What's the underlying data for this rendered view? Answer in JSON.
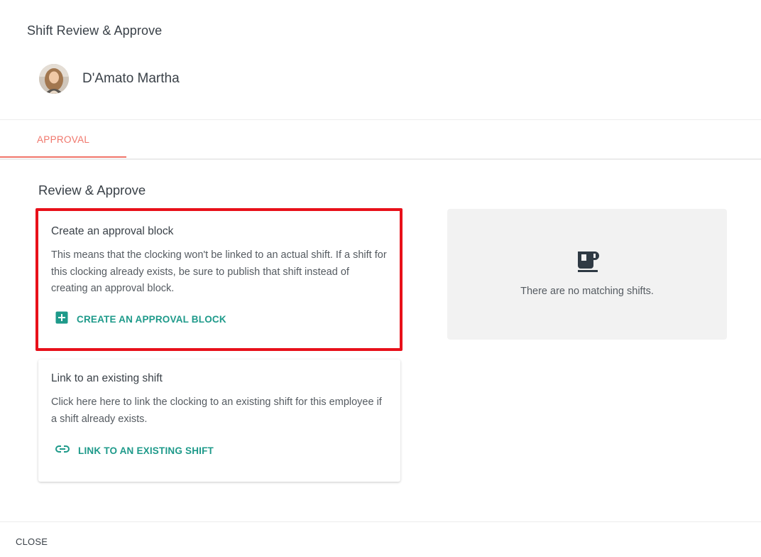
{
  "dialog": {
    "title": "Shift Review & Approve"
  },
  "employee": {
    "name": "D'Amato Martha"
  },
  "tabs": [
    {
      "label": "APPROVAL"
    }
  ],
  "section": {
    "title": "Review & Approve"
  },
  "approval_card": {
    "title": "Create an approval block",
    "description": "This means that the clocking won't be linked to an actual shift. If a shift for this clocking already exists, be sure to publish that shift instead of creating an approval block.",
    "action_label": "CREATE AN APPROVAL BLOCK",
    "action_icon": "plus-square-icon"
  },
  "link_card": {
    "title": "Link to an existing shift",
    "description": "Click here here to link the clocking to an existing shift for this employee if a shift already exists.",
    "action_label": "LINK TO AN EXISTING SHIFT",
    "action_icon": "link-icon"
  },
  "empty_state": {
    "icon": "coffee-cup-icon",
    "message": "There are no matching shifts."
  },
  "footer": {
    "close_label": "CLOSE"
  },
  "colors": {
    "accent_tab": "#f0766b",
    "action_teal": "#1e9a8a",
    "highlight_border": "#e8101a"
  }
}
